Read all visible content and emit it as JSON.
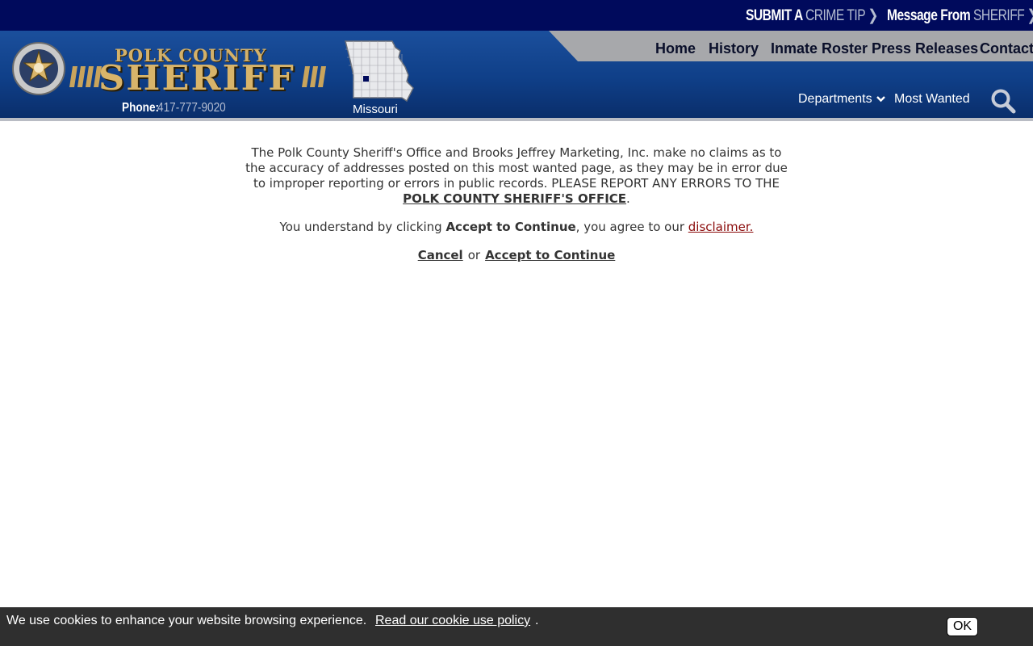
{
  "topbar": {
    "crime_tip_prefix": "SUBMIT A ",
    "crime_tip_highlight": "CRIME TIP",
    "sheriff_prefix": "Message From ",
    "sheriff_highlight": "SHERIFF",
    "chevron": "❯"
  },
  "logo": {
    "title_top": "POLK COUNTY",
    "title_main": "SHERIFF",
    "phone_label": "Phone:",
    "phone_number": "417-777-9020",
    "state": "Missouri"
  },
  "nav": {
    "main": [
      "Home",
      "History",
      "Inmate Roster",
      "Press Releases",
      "Contact"
    ],
    "departments": "Departments",
    "departments_icon": "chevron-down-icon",
    "most_wanted": "Most Wanted",
    "search_icon": "search-icon"
  },
  "content": {
    "notice_text": "The Polk County Sheriff's Office and Brooks Jeffrey Marketing, Inc. make no claims as to the accuracy of addresses posted on this most wanted page, as they may be in error due to improper reporting or errors in public records. PLEASE REPORT ANY ERRORS TO THE ",
    "notice_link": "POLK COUNTY SHERIFF'S OFFICE",
    "notice_end": ".",
    "agree_prefix": "You understand by clicking ",
    "agree_bold": "Accept to Continue",
    "agree_mid": ", you agree to our ",
    "disclaimer_link": "disclaimer.",
    "cancel": "Cancel",
    "or": "or",
    "accept": "Accept to Continue"
  },
  "cookie": {
    "text": "We use cookies to enhance your website browsing experience.",
    "link": "Read our cookie use policy",
    "dot": ".",
    "ok": "OK"
  },
  "colors": {
    "topbar_bg": "#000a5c",
    "header_bg": "#0f3f88",
    "nav_strip": "#a7a8ab",
    "disclaimer_link": "#8a0a0a",
    "cookie_bg": "#2f2f2f"
  }
}
